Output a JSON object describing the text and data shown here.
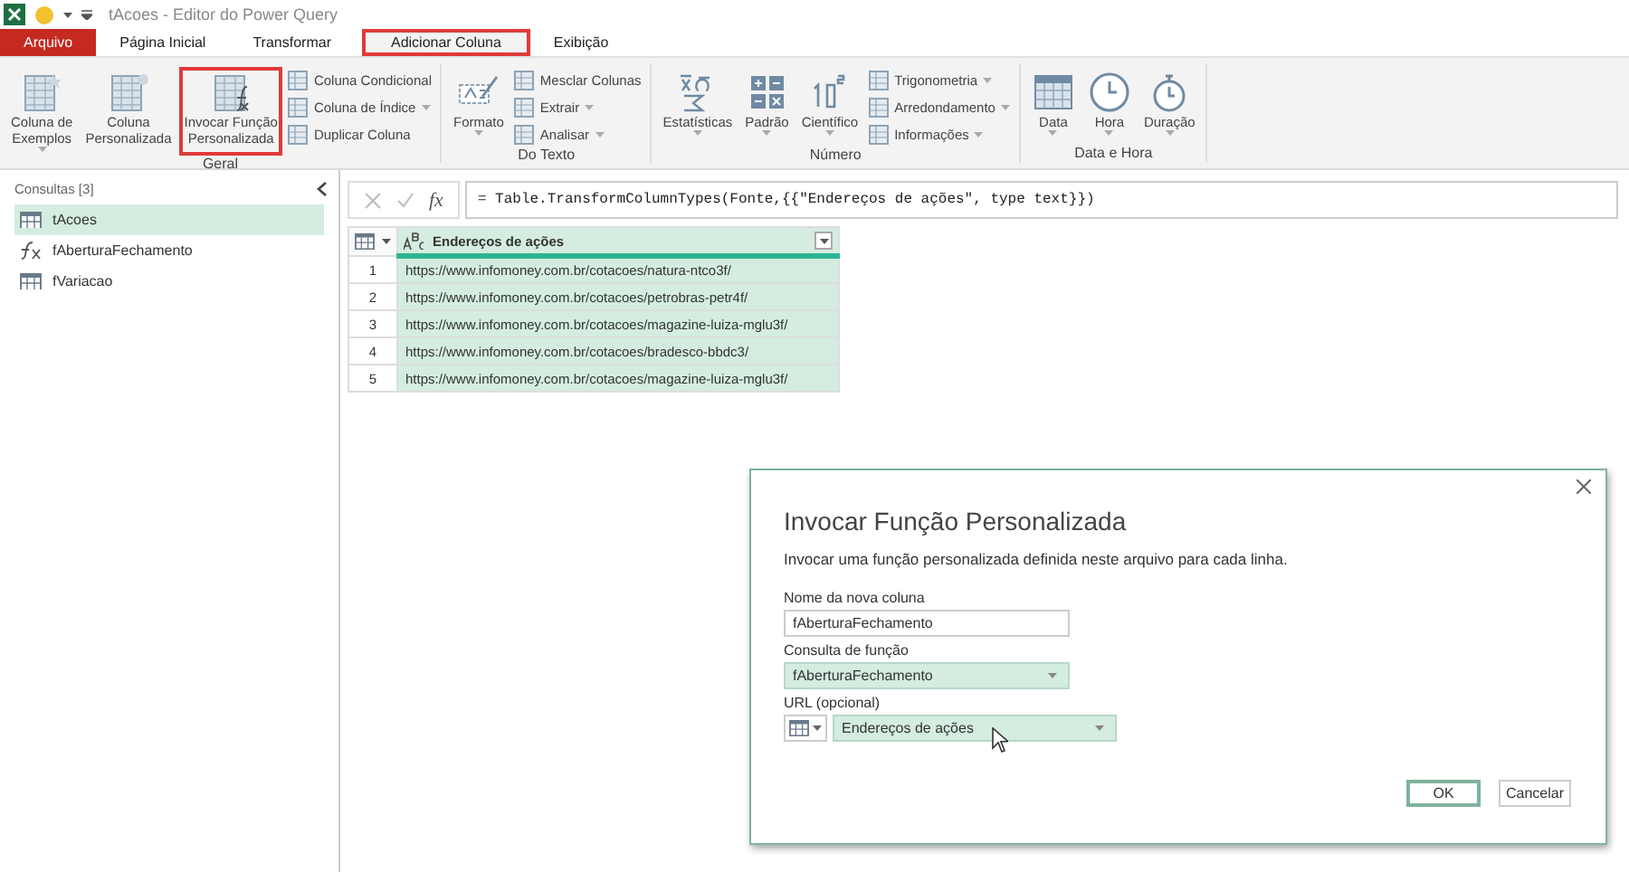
{
  "title_bar": {
    "title": "tAcoes - Editor do Power Query"
  },
  "tabs": [
    {
      "label": "Arquivo",
      "kind": "file",
      "selected": false,
      "highlighted": false
    },
    {
      "label": "Página Inicial",
      "kind": "tab",
      "selected": false,
      "highlighted": false
    },
    {
      "label": "Transformar",
      "kind": "tab",
      "selected": false,
      "highlighted": false
    },
    {
      "label": "Adicionar Coluna",
      "kind": "tab",
      "selected": true,
      "highlighted": true
    },
    {
      "label": "Exibição",
      "kind": "tab",
      "selected": false,
      "highlighted": false
    }
  ],
  "ribbon_groups": [
    {
      "label": "Geral",
      "items": [
        {
          "kind": "large",
          "label": "Coluna de\nExemplos",
          "dropdown": true,
          "highlighted": false
        },
        {
          "kind": "large",
          "label": "Coluna\nPersonalizada",
          "dropdown": false,
          "highlighted": false
        },
        {
          "kind": "large",
          "label": "Invocar Função\nPersonalizada",
          "dropdown": false,
          "highlighted": true
        },
        {
          "kind": "stack",
          "buttons": [
            {
              "label": "Coluna Condicional",
              "dropdown": false
            },
            {
              "label": "Coluna de Índice",
              "dropdown": true
            },
            {
              "label": "Duplicar Coluna",
              "dropdown": false
            }
          ]
        }
      ]
    },
    {
      "label": "Do Texto",
      "items": [
        {
          "kind": "large",
          "label": "Formato",
          "dropdown": true,
          "highlighted": false
        },
        {
          "kind": "stack",
          "buttons": [
            {
              "label": "Mesclar Colunas",
              "dropdown": false
            },
            {
              "label": "Extrair",
              "dropdown": true
            },
            {
              "label": "Analisar",
              "dropdown": true
            }
          ]
        }
      ]
    },
    {
      "label": "Número",
      "items": [
        {
          "kind": "large",
          "label": "Estatísticas",
          "dropdown": true,
          "highlighted": false
        },
        {
          "kind": "large",
          "label": "Padrão",
          "dropdown": true,
          "highlighted": false
        },
        {
          "kind": "large",
          "label": "Científico",
          "dropdown": true,
          "highlighted": false
        },
        {
          "kind": "stack",
          "buttons": [
            {
              "label": "Trigonometria",
              "dropdown": true
            },
            {
              "label": "Arredondamento",
              "dropdown": true
            },
            {
              "label": "Informações",
              "dropdown": true
            }
          ]
        }
      ]
    },
    {
      "label": "Data e Hora",
      "items": [
        {
          "kind": "large",
          "label": "Data",
          "dropdown": true,
          "highlighted": false
        },
        {
          "kind": "large",
          "label": "Hora",
          "dropdown": true,
          "highlighted": false
        },
        {
          "kind": "large",
          "label": "Duração",
          "dropdown": true,
          "highlighted": false
        }
      ]
    }
  ],
  "sidebar": {
    "header": "Consultas [3]",
    "items": [
      {
        "name": "tAcoes",
        "kind": "table",
        "selected": true
      },
      {
        "name": "fAberturaFechamento",
        "kind": "function",
        "selected": false
      },
      {
        "name": "fVariacao",
        "kind": "table",
        "selected": false
      }
    ]
  },
  "formula_bar": {
    "fx": "fx",
    "formula": "= Table.TransformColumnTypes(Fonte,{{\"Endereços de ações\", type text}})"
  },
  "table": {
    "columns": [
      {
        "name": "Endereços de ações",
        "selected": true
      }
    ],
    "rows": [
      {
        "number": "1",
        "values": [
          "https://www.infomoney.com.br/cotacoes/natura-ntco3f/"
        ]
      },
      {
        "number": "2",
        "values": [
          "https://www.infomoney.com.br/cotacoes/petrobras-petr4f/"
        ]
      },
      {
        "number": "3",
        "values": [
          "https://www.infomoney.com.br/cotacoes/magazine-luiza-mglu3f/"
        ]
      },
      {
        "number": "4",
        "values": [
          "https://www.infomoney.com.br/cotacoes/bradesco-bbdc3/"
        ]
      },
      {
        "number": "5",
        "values": [
          "https://www.infomoney.com.br/cotacoes/magazine-luiza-mglu3f/"
        ]
      }
    ]
  },
  "dialog": {
    "title": "Invocar Função Personalizada",
    "description": "Invocar uma função personalizada definida neste arquivo para cada linha.",
    "fields": [
      {
        "kind": "text",
        "label": "Nome da nova coluna",
        "value": "fAberturaFechamento"
      },
      {
        "kind": "select",
        "label": "Consulta de função",
        "value": "fAberturaFechamento"
      },
      {
        "kind": "column_select",
        "label": "URL (opcional)",
        "value": "Endereços de ações"
      }
    ],
    "buttons": [
      {
        "label": "OK",
        "default": true
      },
      {
        "label": "Cancelar",
        "default": false
      }
    ]
  }
}
